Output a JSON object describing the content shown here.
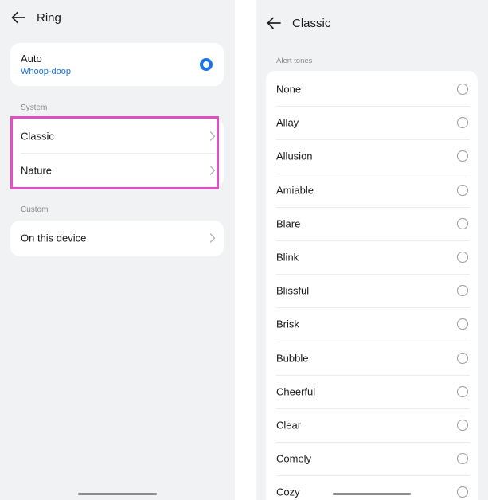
{
  "left_screen": {
    "title": "Ring",
    "auto_card": {
      "label": "Auto",
      "sublabel": "Whoop-doop",
      "selected": true
    },
    "system_section": {
      "header": "System",
      "items": [
        {
          "label": "Classic"
        },
        {
          "label": "Nature"
        }
      ]
    },
    "custom_section": {
      "header": "Custom",
      "items": [
        {
          "label": "On this device"
        }
      ]
    }
  },
  "right_screen": {
    "title": "Classic",
    "section_header": "Alert tones",
    "tones": [
      {
        "label": "None"
      },
      {
        "label": "Allay"
      },
      {
        "label": "Allusion"
      },
      {
        "label": "Amiable"
      },
      {
        "label": "Blare"
      },
      {
        "label": "Blink"
      },
      {
        "label": "Blissful"
      },
      {
        "label": "Brisk"
      },
      {
        "label": "Bubble"
      },
      {
        "label": "Cheerful"
      },
      {
        "label": "Clear"
      },
      {
        "label": "Comely"
      },
      {
        "label": "Cozy"
      }
    ]
  },
  "colors": {
    "accent": "#1a73e8",
    "highlight": "#e04fc4",
    "background": "#f1f2f4"
  },
  "icons": {
    "back": "arrow-left-icon",
    "chevron": "chevron-right-icon",
    "radio_on": "radio-selected-icon",
    "radio_off": "radio-unselected-icon"
  }
}
